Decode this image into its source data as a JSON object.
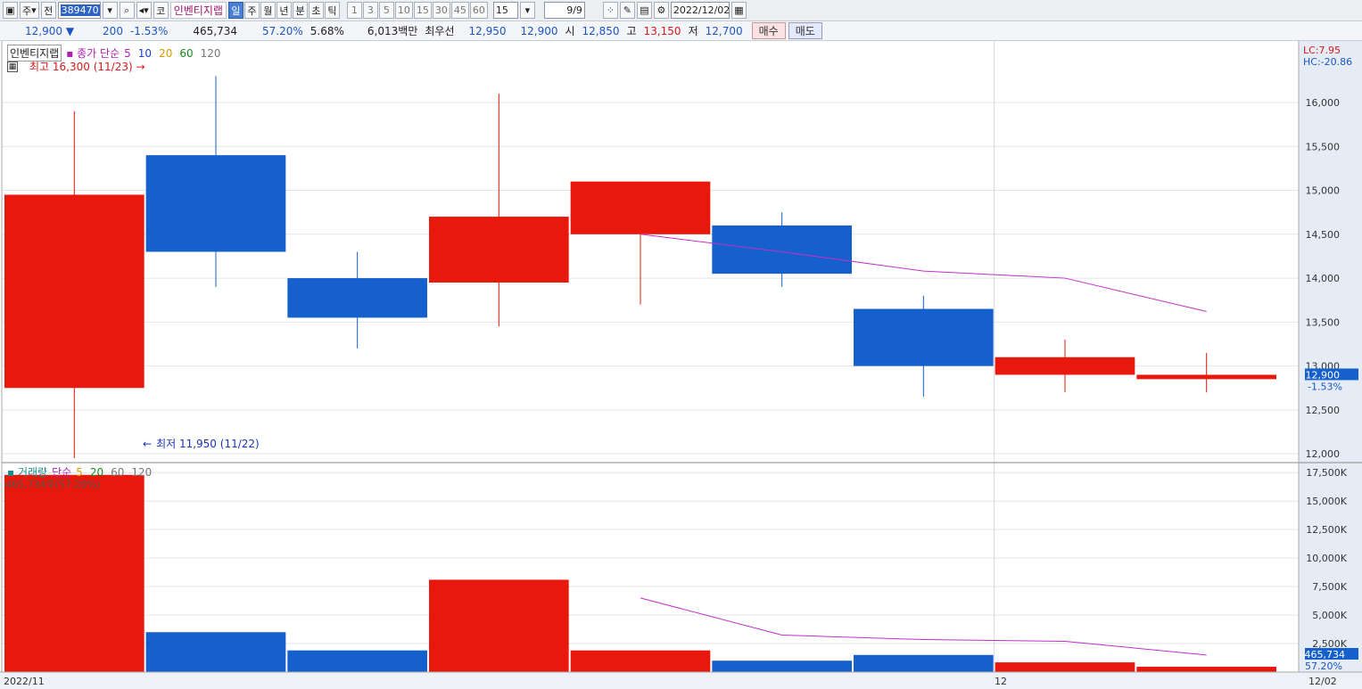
{
  "toolbar": {
    "period_label": "주",
    "prev_label": "전",
    "code": "389470",
    "market": "코",
    "stock_name": "인벤티지랩",
    "tabs": [
      "일",
      "주",
      "월",
      "년",
      "분",
      "초",
      "틱"
    ],
    "active_tab": 0,
    "minute_units": [
      "1",
      "3",
      "5",
      "10",
      "15",
      "30",
      "45",
      "60"
    ],
    "unit_value": "15",
    "page": "9/9",
    "date": "2022/12/02"
  },
  "info": {
    "price": "12,900",
    "change": "200",
    "change_pct": "-1.53%",
    "volume": "465,734",
    "vol_ratio": "57.20%",
    "turnover": "5.68%",
    "amount": "6,013백만",
    "best_label": "최우선",
    "best_ask": "12,950",
    "best_bid": "12,900",
    "open_label": "시",
    "open": "12,850",
    "high_label": "고",
    "high": "13,150",
    "low_label": "저",
    "low": "12,700",
    "buy_label": "매수",
    "sell_label": "매도"
  },
  "price_panel": {
    "title": "인벤티지랩",
    "ma_label": "종가 단순",
    "ma_periods": [
      "5",
      "10",
      "20",
      "60",
      "120"
    ],
    "ma_colors": [
      "#b01fb0",
      "#1a3fd6",
      "#d99a00",
      "#1a8a1a",
      "#777777"
    ],
    "high_note": "최고 16,300 (11/23)",
    "low_note": "최저 11,950 (11/22)",
    "lc": "LC:7.95",
    "hc": "HC:-20.86",
    "cur_price": "12,900",
    "cur_pct": "-1.53%",
    "yticks": [
      "16,000",
      "15,500",
      "15,000",
      "14,500",
      "14,000",
      "13,500",
      "13,000",
      "12,500",
      "12,000"
    ]
  },
  "volume_panel": {
    "title": "거래량",
    "ma_label": "단순",
    "ma_periods": [
      "5",
      "20",
      "60",
      "120"
    ],
    "cur_vol_note": "465,734주(57.20%)",
    "cur_vol": "465,734",
    "cur_pct": "57.20%",
    "yticks": [
      "17,500K",
      "15,000K",
      "12,500K",
      "10,000K",
      "7,500K",
      "5,000K",
      "2,500K"
    ]
  },
  "xaxis": {
    "left_label": "2022/11",
    "mid_label": "12",
    "right_label": "12/02"
  },
  "colors": {
    "up": "#e8180c",
    "down": "#1560cc",
    "ma5": "#c030c8"
  },
  "chart_data": {
    "type": "candlestick",
    "candles": [
      {
        "o": 12750,
        "h": 15900,
        "l": 11950,
        "c": 14950
      },
      {
        "o": 15400,
        "h": 16300,
        "l": 13900,
        "c": 14300
      },
      {
        "o": 14000,
        "h": 14300,
        "l": 13200,
        "c": 13550
      },
      {
        "o": 13950,
        "h": 16100,
        "l": 13450,
        "c": 14700
      },
      {
        "o": 14500,
        "h": 15100,
        "l": 13700,
        "c": 15100
      },
      {
        "o": 14600,
        "h": 14750,
        "l": 13900,
        "c": 14050
      },
      {
        "o": 13650,
        "h": 13800,
        "l": 12650,
        "c": 13000
      },
      {
        "o": 12900,
        "h": 13300,
        "l": 12700,
        "c": 13100
      },
      {
        "o": 12850,
        "h": 13150,
        "l": 12700,
        "c": 12900
      }
    ],
    "ma5": [
      null,
      null,
      null,
      null,
      14500,
      14300,
      14080,
      14000,
      13620
    ],
    "volumes": [
      17300,
      3500,
      1900,
      8100,
      1900,
      1000,
      1500,
      850,
      466
    ],
    "volume_ma5": [
      null,
      null,
      null,
      null,
      6500,
      3250,
      2850,
      2700,
      1500
    ],
    "ylim": [
      11900,
      16700
    ],
    "vol_ylim": [
      0,
      18300
    ]
  }
}
